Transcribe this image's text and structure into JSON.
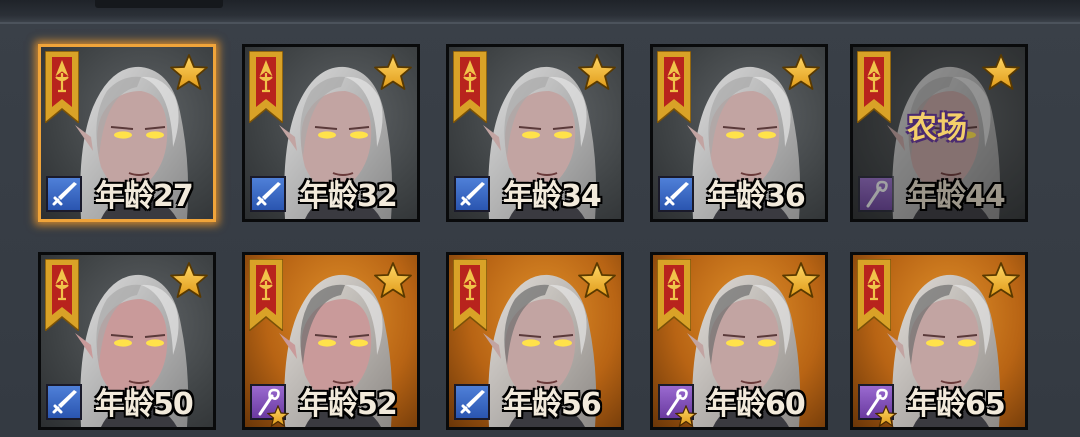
{
  "age_prefix": "年龄",
  "colors": {
    "selected_border": "#f0a43a",
    "banner_gold": "#d9a227",
    "banner_red": "#b8231d",
    "star_gold": "#f2b635",
    "class_blue": "#3a6ac8",
    "class_purple": "#7a4ab8",
    "farm_label": "#f3cf6a"
  },
  "characters": [
    {
      "age_label": "年龄27",
      "class_icon": "sword-icon",
      "selected": true,
      "background": "gray",
      "status": "",
      "dimmed": false,
      "class_star": false
    },
    {
      "age_label": "年龄32",
      "class_icon": "sword-icon",
      "selected": false,
      "background": "gray",
      "status": "",
      "dimmed": false,
      "class_star": false
    },
    {
      "age_label": "年龄34",
      "class_icon": "sword-icon",
      "selected": false,
      "background": "gray",
      "status": "",
      "dimmed": false,
      "class_star": false
    },
    {
      "age_label": "年龄36",
      "class_icon": "sword-icon",
      "selected": false,
      "background": "gray",
      "status": "",
      "dimmed": false,
      "class_star": false
    },
    {
      "age_label": "年龄44",
      "class_icon": "staff-icon",
      "selected": false,
      "background": "gray",
      "status": "农场",
      "dimmed": true,
      "class_star": false
    },
    {
      "age_label": "年龄50",
      "class_icon": "sword-icon",
      "selected": false,
      "background": "gray",
      "status": "",
      "dimmed": false,
      "class_star": false
    },
    {
      "age_label": "年龄52",
      "class_icon": "staff-icon",
      "selected": false,
      "background": "orange",
      "status": "",
      "dimmed": false,
      "class_star": true
    },
    {
      "age_label": "年龄56",
      "class_icon": "sword-icon",
      "selected": false,
      "background": "orange",
      "status": "",
      "dimmed": false,
      "class_star": false
    },
    {
      "age_label": "年龄60",
      "class_icon": "staff-icon",
      "selected": false,
      "background": "orange",
      "status": "",
      "dimmed": false,
      "class_star": true
    },
    {
      "age_label": "年龄65",
      "class_icon": "staff-icon",
      "selected": false,
      "background": "orange",
      "status": "",
      "dimmed": false,
      "class_star": true
    }
  ]
}
